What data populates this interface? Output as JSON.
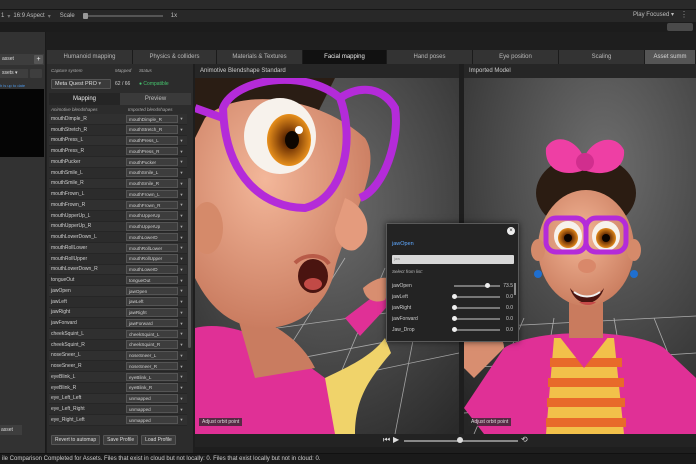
{
  "game_view": {
    "display": "1",
    "aspect": "16:9 Aspect",
    "scale_label": "Scale",
    "scale_value": "1x",
    "play_focused": "Play Focused"
  },
  "left_panel": {
    "add_asset": "asset",
    "assets_dropdown": "ssets",
    "link": "h is up to date",
    "bottom_button": "asset"
  },
  "tabs": [
    {
      "label": "Humanoid mapping"
    },
    {
      "label": "Physics & colliders"
    },
    {
      "label": "Materials & Textures"
    },
    {
      "label": "Facial mapping"
    },
    {
      "label": "Hand poses"
    },
    {
      "label": "Eye position"
    },
    {
      "label": "Scaling"
    },
    {
      "label": "Asset summ"
    }
  ],
  "capture": {
    "system_label": "Capture system",
    "mapped_label": "Mapped",
    "status_label": "Status",
    "system_value": "Meta Quest PRO",
    "mapped_value": "62 / 66",
    "status_value": "Compatible",
    "tab_mapping": "Mapping",
    "tab_preview": "Preview",
    "col_a": "Animotive blendshapes",
    "col_b": "Imported blendshapes",
    "rows": [
      {
        "name": "mouthDimple_R",
        "value": "mouthDimple_R"
      },
      {
        "name": "mouthStretch_R",
        "value": "mouthStretch_R"
      },
      {
        "name": "mouthPress_L",
        "value": "mouthPress_L"
      },
      {
        "name": "mouthPress_R",
        "value": "mouthPress_R"
      },
      {
        "name": "mouthPucker",
        "value": "mouthPucker"
      },
      {
        "name": "mouthSmile_L",
        "value": "mouthSmile_L"
      },
      {
        "name": "mouthSmile_R",
        "value": "mouthSmile_R"
      },
      {
        "name": "mouthFrown_L",
        "value": "mouthFrown_L"
      },
      {
        "name": "mouthFrown_R",
        "value": "mouthFrown_R"
      },
      {
        "name": "mouthUpperUp_L",
        "value": "mouthUpperUp"
      },
      {
        "name": "mouthUpperUp_R",
        "value": "mouthUpperUp"
      },
      {
        "name": "mouthLowerDown_L",
        "value": "mouthLowerD"
      },
      {
        "name": "mouthRollLower",
        "value": "mouthRollLower"
      },
      {
        "name": "mouthRollUpper",
        "value": "mouthRollUpper"
      },
      {
        "name": "mouthLowerDown_R",
        "value": "mouthLowerD"
      },
      {
        "name": "tongueOut",
        "value": "tongueOut"
      },
      {
        "name": "jawOpen",
        "value": "jawOpen"
      },
      {
        "name": "jawLeft",
        "value": "jawLeft"
      },
      {
        "name": "jawRight",
        "value": "jawRight"
      },
      {
        "name": "jawForward",
        "value": "jawForward"
      },
      {
        "name": "cheekSquint_L",
        "value": "cheekSquint_L"
      },
      {
        "name": "cheekSquint_R",
        "value": "cheekSquint_R"
      },
      {
        "name": "noseSneer_L",
        "value": "noseSneer_L"
      },
      {
        "name": "noseSneer_R",
        "value": "noseSneer_R"
      },
      {
        "name": "eyeBlink_L",
        "value": "eyeBlink_L"
      },
      {
        "name": "eyeBlink_R",
        "value": "eyeBlink_R"
      },
      {
        "name": "eye_Left_Left",
        "value": "unmapped"
      },
      {
        "name": "eye_Left_Right",
        "value": "unmapped"
      },
      {
        "name": "eye_Right_Left",
        "value": "unmapped"
      }
    ],
    "btn_revert": "Revert to automap",
    "btn_save": "Save Profile",
    "btn_load": "Load Profile"
  },
  "viewport_left": {
    "title": "Animotive Blendshape Standard",
    "note": "Adjust orbit point"
  },
  "viewport_right": {
    "title": "Imported Model",
    "note": "Adjust orbit point"
  },
  "dialog": {
    "title": "jawOpen",
    "search_placeholder": "jaw",
    "hint": "Select from list:",
    "items": [
      {
        "name": "jawOpen",
        "value": "73.5",
        "level": 0.735
      },
      {
        "name": "jawLeft",
        "value": "0.0",
        "level": 0
      },
      {
        "name": "jawRight",
        "value": "0.0",
        "level": 0
      },
      {
        "name": "jawForward",
        "value": "0.0",
        "level": 0
      },
      {
        "name": "Jaw_Drop",
        "value": "0.0",
        "level": 0
      }
    ]
  },
  "status_bar": "ile Comparison Completed for Assets. Files that exist in cloud but not locally: 0. Files that exist locally but not in cloud: 0.",
  "colors": {
    "accent_blue": "#5ea8ff",
    "ok_green": "#46c46e",
    "magenta": "#e0309a"
  }
}
